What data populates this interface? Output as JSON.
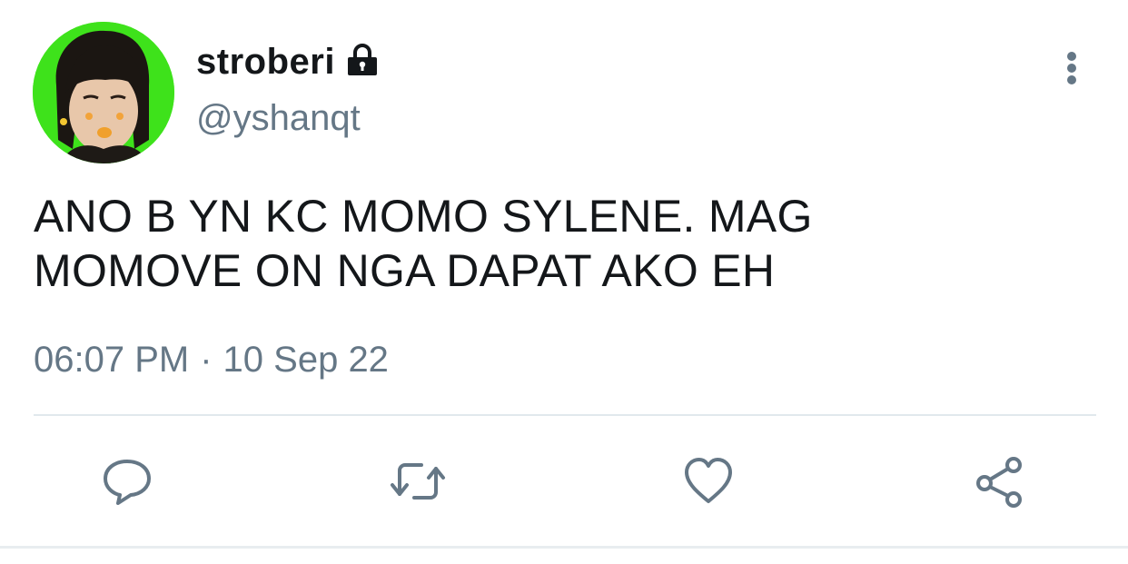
{
  "tweet": {
    "author": {
      "display_name": "stroberi",
      "handle": "@yshanqt",
      "protected_icon": "lock-icon",
      "avatar_background": "#3ee21b"
    },
    "text_line_1": "ANO B YN KC MOMO SYLENE. MAG",
    "text_line_2": "MOMOVE ON NGA DAPAT AKO EH",
    "time": "06:07 PM",
    "separator": "·",
    "date": "10 Sep 22"
  },
  "actions": {
    "reply_icon": "speech-bubble-icon",
    "retweet_icon": "retweet-arrows-icon",
    "like_icon": "heart-icon",
    "share_icon": "share-nodes-icon",
    "more_icon": "vertical-ellipsis-icon",
    "icon_color": "#657786"
  }
}
